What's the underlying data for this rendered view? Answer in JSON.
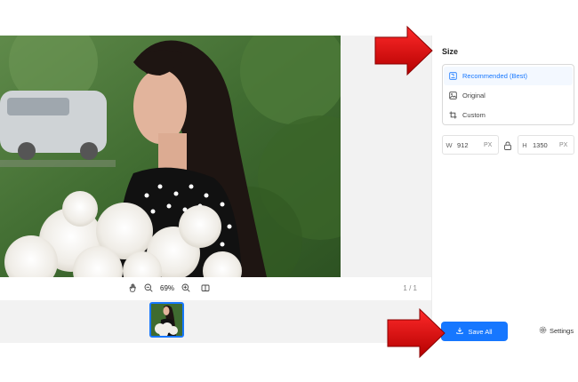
{
  "zoom": {
    "percent": "69%",
    "page_indicator": "1 / 1"
  },
  "size_panel": {
    "title": "Size",
    "options": [
      {
        "label": "Recommended (Best)",
        "icon": "recommended-icon",
        "selected": true
      },
      {
        "label": "Original",
        "icon": "image-icon",
        "selected": false
      },
      {
        "label": "Custom",
        "icon": "crop-icon",
        "selected": false
      }
    ],
    "width": {
      "label": "W",
      "value": "912",
      "unit": "PX"
    },
    "height": {
      "label": "H",
      "value": "1350",
      "unit": "PX"
    }
  },
  "actions": {
    "save_all": "Save All",
    "settings": "Settings"
  },
  "colors": {
    "accent": "#1677ff",
    "arrow": "#e3000f"
  }
}
